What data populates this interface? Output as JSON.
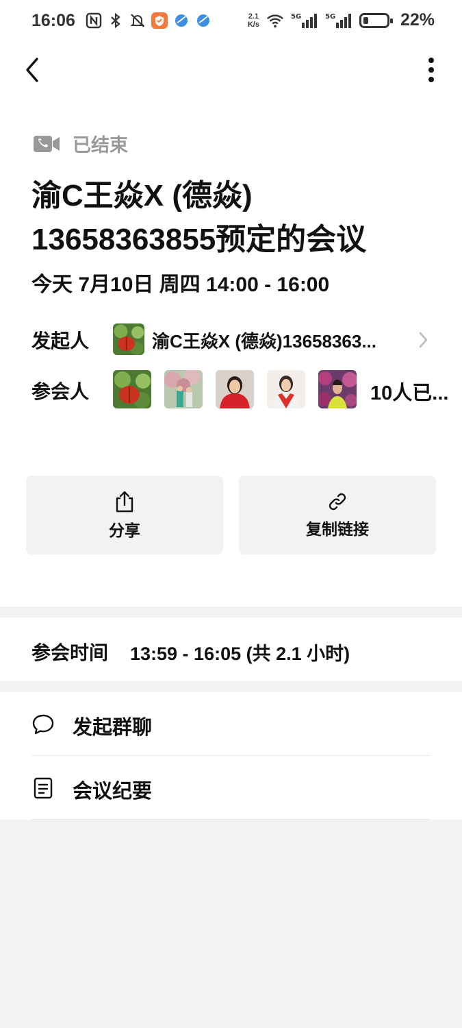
{
  "status_bar": {
    "time": "16:06",
    "net_speed_value": "2.1",
    "net_speed_unit": "K/s",
    "network_1": "5G",
    "network_2": "5G",
    "battery_percent": "22%",
    "battery_level": 0.22
  },
  "meeting": {
    "status_label": "已结束",
    "title_line1": "渝C王焱X (德焱)",
    "title_line2": "13658363855预定的会议",
    "datetime": "今天 7月10日 周四 14:00 - 16:00"
  },
  "host": {
    "label": "发起人",
    "name": "渝C王焱X (德焱)13658363..."
  },
  "attendees": {
    "label": "参会人",
    "count_text": "10人已...",
    "avatars": [
      "avatar-red-leaf",
      "avatar-blossom",
      "avatar-woman-red",
      "avatar-woman-scarf",
      "avatar-woman-flowers"
    ]
  },
  "actions": {
    "share_label": "分享",
    "copy_link_label": "复制链接"
  },
  "attendance": {
    "label": "参会时间",
    "value": "13:59 - 16:05 (共 2.1 小时)"
  },
  "menu": {
    "group_chat_label": "发起群聊",
    "minutes_label": "会议纪要"
  },
  "colors": {
    "muted": "#999999",
    "card_bg": "#f2f2f2",
    "accent_badge": "#f37a3b"
  }
}
